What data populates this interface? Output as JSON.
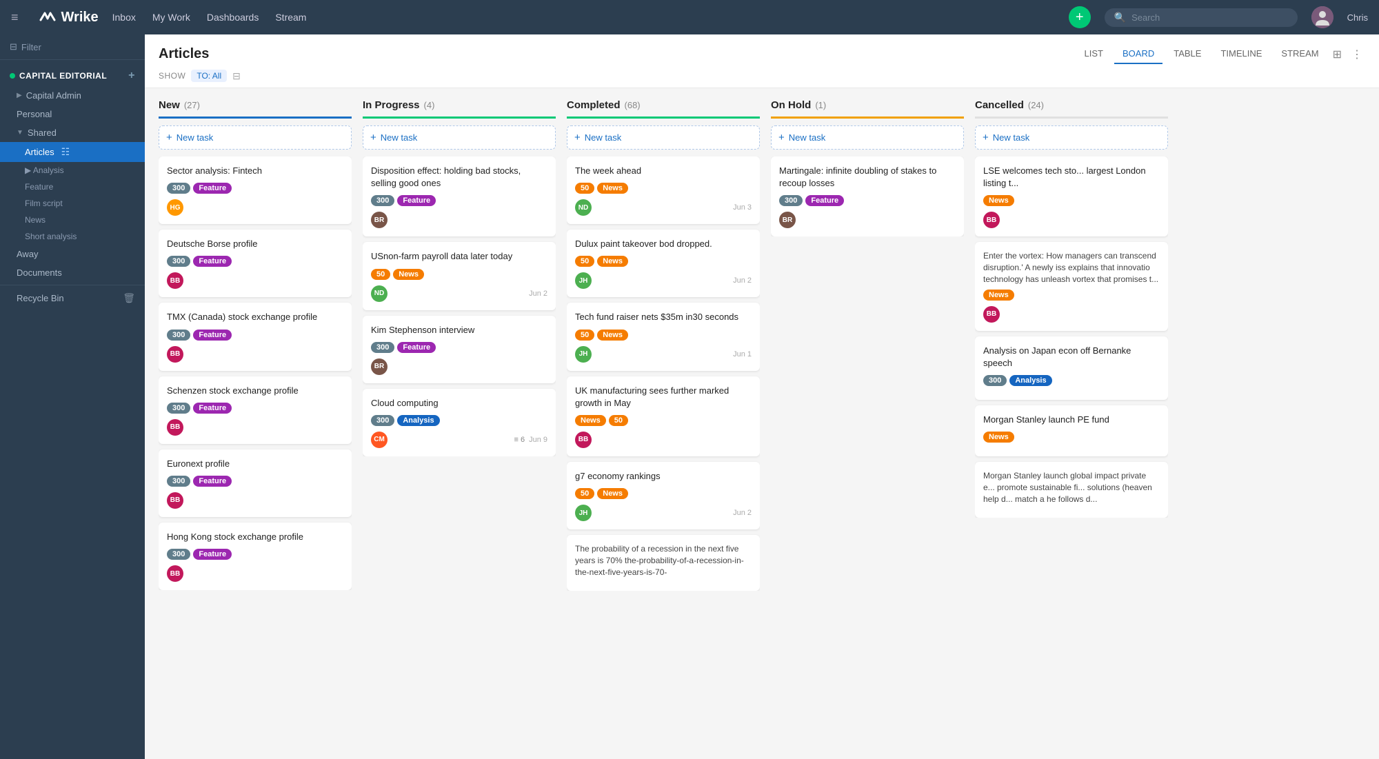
{
  "app": {
    "name": "Wrike"
  },
  "topNav": {
    "hamburger": "≡",
    "addBtn": "+",
    "links": [
      "Inbox",
      "My Work",
      "Dashboards",
      "Stream"
    ],
    "search": {
      "placeholder": "Search"
    },
    "userName": "Chris"
  },
  "sidebar": {
    "filter": "Filter",
    "groupName": "CAPITAL EDITORIAL",
    "items": [
      {
        "label": "Capital Admin",
        "indent": 1
      },
      {
        "label": "Personal",
        "indent": 1
      },
      {
        "label": "Shared",
        "indent": 1,
        "expanded": true
      },
      {
        "label": "Articles",
        "indent": 2,
        "active": true
      },
      {
        "label": "Analysis",
        "indent": 3
      },
      {
        "label": "Feature",
        "indent": 3
      },
      {
        "label": "Film script",
        "indent": 3
      },
      {
        "label": "News",
        "indent": 3
      },
      {
        "label": "Short analysis",
        "indent": 3
      }
    ],
    "away": "Away",
    "documents": "Documents",
    "recycleBin": "Recycle Bin"
  },
  "page": {
    "title": "Articles",
    "tabs": [
      "LIST",
      "BOARD",
      "TABLE",
      "TIMELINE",
      "STREAM"
    ],
    "activeTab": "BOARD",
    "showLabel": "SHOW",
    "toAll": "TO: All"
  },
  "columns": [
    {
      "id": "new",
      "title": "New",
      "count": "27",
      "colorClass": "new-col",
      "newTaskLabel": "New task",
      "cards": [
        {
          "title": "Sector analysis: Fintech",
          "tags": [
            {
              "label": "300",
              "cls": "tag-300"
            },
            {
              "label": "Feature",
              "cls": "tag-feature"
            }
          ],
          "avatar": {
            "initials": "HG",
            "cls": "avatar-hg"
          },
          "date": ""
        },
        {
          "title": "Deutsche Borse profile",
          "tags": [
            {
              "label": "300",
              "cls": "tag-300"
            },
            {
              "label": "Feature",
              "cls": "tag-feature"
            }
          ],
          "avatar": {
            "initials": "BB",
            "cls": "avatar-bb"
          },
          "date": ""
        },
        {
          "title": "TMX (Canada) stock exchange profile",
          "tags": [
            {
              "label": "300",
              "cls": "tag-300"
            },
            {
              "label": "Feature",
              "cls": "tag-feature"
            }
          ],
          "avatar": {
            "initials": "BB",
            "cls": "avatar-bb"
          },
          "date": ""
        },
        {
          "title": "Schenzen stock exchange profile",
          "tags": [
            {
              "label": "300",
              "cls": "tag-300"
            },
            {
              "label": "Feature",
              "cls": "tag-feature"
            }
          ],
          "avatar": {
            "initials": "BB",
            "cls": "avatar-bb"
          },
          "date": ""
        },
        {
          "title": "Euronext profile",
          "tags": [
            {
              "label": "300",
              "cls": "tag-300"
            },
            {
              "label": "Feature",
              "cls": "tag-feature"
            }
          ],
          "avatar": {
            "initials": "BB",
            "cls": "avatar-bb"
          },
          "date": ""
        },
        {
          "title": "Hong Kong stock exchange profile",
          "tags": [
            {
              "label": "300",
              "cls": "tag-300"
            },
            {
              "label": "Feature",
              "cls": "tag-feature"
            }
          ],
          "avatar": {
            "initials": "BB",
            "cls": "avatar-bb"
          },
          "date": ""
        }
      ]
    },
    {
      "id": "inprogress",
      "title": "In Progress",
      "count": "4",
      "colorClass": "inprogress-col",
      "newTaskLabel": "New task",
      "cards": [
        {
          "title": "Disposition effect: holding bad stocks, selling good ones",
          "tags": [
            {
              "label": "300",
              "cls": "tag-300"
            },
            {
              "label": "Feature",
              "cls": "tag-feature"
            }
          ],
          "avatar": {
            "initials": "BR",
            "cls": "avatar-brown"
          },
          "date": ""
        },
        {
          "title": "USnon-farm payroll data later today",
          "tags": [
            {
              "label": "50",
              "cls": "tag-50"
            },
            {
              "label": "News",
              "cls": "tag-news"
            }
          ],
          "avatar": {
            "initials": "ND",
            "cls": "avatar-nd"
          },
          "date": "Jun 2"
        },
        {
          "title": "Kim Stephenson interview",
          "tags": [
            {
              "label": "300",
              "cls": "tag-300"
            },
            {
              "label": "Feature",
              "cls": "tag-feature"
            }
          ],
          "avatar": {
            "initials": "BR",
            "cls": "avatar-brown"
          },
          "date": ""
        },
        {
          "title": "Cloud computing",
          "tags": [
            {
              "label": "300",
              "cls": "tag-300"
            },
            {
              "label": "Analysis",
              "cls": "tag-analysis"
            }
          ],
          "avatar": {
            "initials": "CM",
            "cls": "avatar-cm"
          },
          "date": "Jun 9",
          "subtasks": "6"
        }
      ]
    },
    {
      "id": "completed",
      "title": "Completed",
      "count": "68",
      "colorClass": "completed-col",
      "newTaskLabel": "New task",
      "cards": [
        {
          "title": "The week ahead",
          "tags": [
            {
              "label": "50",
              "cls": "tag-50"
            },
            {
              "label": "News",
              "cls": "tag-news"
            }
          ],
          "avatar": {
            "initials": "ND",
            "cls": "avatar-nd"
          },
          "date": "Jun 3"
        },
        {
          "title": "Dulux paint takeover bod dropped.",
          "tags": [
            {
              "label": "50",
              "cls": "tag-50"
            },
            {
              "label": "News",
              "cls": "tag-news"
            }
          ],
          "avatar": {
            "initials": "JH",
            "cls": "avatar-jh"
          },
          "date": "Jun 2"
        },
        {
          "title": "Tech fund raiser nets $35m in30 seconds",
          "tags": [
            {
              "label": "50",
              "cls": "tag-50"
            },
            {
              "label": "News",
              "cls": "tag-news"
            }
          ],
          "avatar": {
            "initials": "JH",
            "cls": "avatar-jh"
          },
          "date": "Jun 1"
        },
        {
          "title": "UK manufacturing sees further marked growth in May",
          "tags": [
            {
              "label": "News",
              "cls": "tag-news"
            },
            {
              "label": "50",
              "cls": "tag-50"
            }
          ],
          "avatar": {
            "initials": "BB",
            "cls": "avatar-bb"
          },
          "date": ""
        },
        {
          "title": "g7 economy rankings",
          "tags": [
            {
              "label": "50",
              "cls": "tag-50"
            },
            {
              "label": "News",
              "cls": "tag-news"
            }
          ],
          "avatar": {
            "initials": "JH",
            "cls": "avatar-jh"
          },
          "date": "Jun 2"
        },
        {
          "title": "The probability of a recession in the next five years is 70% the-probability-of-a-recession-in-the-next-five-years-is-70-",
          "tags": [],
          "avatar": null,
          "date": "",
          "longText": true
        }
      ]
    },
    {
      "id": "onhold",
      "title": "On Hold",
      "count": "1",
      "colorClass": "onhold-col",
      "newTaskLabel": "New task",
      "cards": [
        {
          "title": "Martingale: infinite doubling of stakes to recoup losses",
          "tags": [
            {
              "label": "300",
              "cls": "tag-300"
            },
            {
              "label": "Feature",
              "cls": "tag-feature"
            }
          ],
          "avatar": {
            "initials": "BR",
            "cls": "avatar-brown"
          },
          "date": ""
        }
      ]
    },
    {
      "id": "cancelled",
      "title": "Cancelled",
      "count": "24",
      "colorClass": "cancelled-col",
      "newTaskLabel": "New task",
      "cards": [
        {
          "title": "LSE welcomes tech sto... largest London listing t...",
          "tags": [
            {
              "label": "News",
              "cls": "tag-news"
            }
          ],
          "avatar": {
            "initials": "BB",
            "cls": "avatar-bb"
          },
          "date": ""
        },
        {
          "title": "Enter the vortex: How managers can transcend disruption.' A newly iss explains that innovatio technology has unleash vortex that promises t...",
          "tags": [
            {
              "label": "News",
              "cls": "tag-news"
            }
          ],
          "avatar": {
            "initials": "BB",
            "cls": "avatar-bb"
          },
          "date": "",
          "longText": true
        },
        {
          "title": "Analysis on Japan econ off Bernanke speech",
          "tags": [
            {
              "label": "300",
              "cls": "tag-300"
            },
            {
              "label": "Analysis",
              "cls": "tag-analysis"
            }
          ],
          "avatar": null,
          "date": ""
        },
        {
          "title": "Morgan Stanley launch PE fund",
          "tags": [
            {
              "label": "News",
              "cls": "tag-news"
            }
          ],
          "avatar": null,
          "date": ""
        },
        {
          "title": "Morgan Stanley launch global impact private e... promote sustainable fi... solutions (heaven help d... match a he follows d...",
          "tags": [],
          "avatar": null,
          "date": "",
          "longText": true
        }
      ]
    }
  ]
}
